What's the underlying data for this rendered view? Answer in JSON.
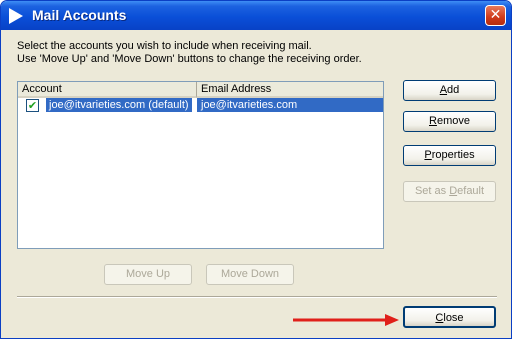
{
  "window": {
    "title": "Mail Accounts",
    "close_glyph": "✕",
    "icon": "arrow-right-icon"
  },
  "instructions": {
    "line1": "Select the accounts you wish to include when receiving mail.",
    "line2": "Use 'Move Up' and 'Move Down' buttons to change the receiving order."
  },
  "list": {
    "columns": [
      "Account",
      "Email Address"
    ],
    "rows": [
      {
        "checked": true,
        "account": "joe@itvarieties.com (default)",
        "email": "joe@itvarieties.com",
        "selected": true
      }
    ],
    "check_glyph": "✔"
  },
  "buttons": {
    "add": {
      "first": "A",
      "rest": "dd",
      "enabled": true
    },
    "remove": {
      "first": "R",
      "rest": "emove",
      "enabled": true
    },
    "properties": {
      "first": "P",
      "rest": "roperties",
      "enabled": true
    },
    "set_default": {
      "pre": "Set as ",
      "under": "D",
      "post": "efault",
      "enabled": false
    },
    "move_up": {
      "label": "Move Up",
      "enabled": false
    },
    "move_down": {
      "label": "Move Down",
      "enabled": false
    },
    "close": {
      "first": "C",
      "rest": "lose",
      "enabled": true
    }
  },
  "colors": {
    "titlebar": "#0a4fd8",
    "selection": "#316ac5",
    "annotation_arrow": "#e0201a",
    "checkmark": "#21a121"
  }
}
